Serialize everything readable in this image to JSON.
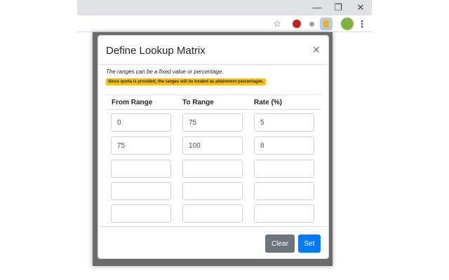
{
  "browser": {
    "window_controls": {
      "minimize": "—",
      "restore": "❐",
      "close": "✕"
    },
    "toolbar_icons": [
      "star-icon",
      "extension-badge-icon",
      "extension-dot-icon",
      "extension-active-icon",
      "profile-avatar",
      "menu-kebab-icon"
    ],
    "star_glyph": "☆",
    "kebab_glyph": "⋮"
  },
  "modal": {
    "title": "Define Lookup Matrix",
    "close_glyph": "×",
    "intro_text": "The ranges can be a fixed value or percentage.",
    "notice_text": "Since quota is provided, the ranges will be treated as attainment percentages.",
    "columns": [
      "From Range",
      "To Range",
      "Rate (%)"
    ],
    "rows": [
      [
        "0",
        "75",
        "5"
      ],
      [
        "75",
        "100",
        "8"
      ],
      [
        "",
        "",
        ""
      ],
      [
        "",
        "",
        ""
      ],
      [
        "",
        "",
        ""
      ]
    ],
    "clear_label": "Clear",
    "set_label": "Set"
  },
  "colors": {
    "notice_bg": "#ffc107",
    "primary": "#007bff",
    "secondary": "#6c757d",
    "backdrop": "#6b6b6b"
  }
}
